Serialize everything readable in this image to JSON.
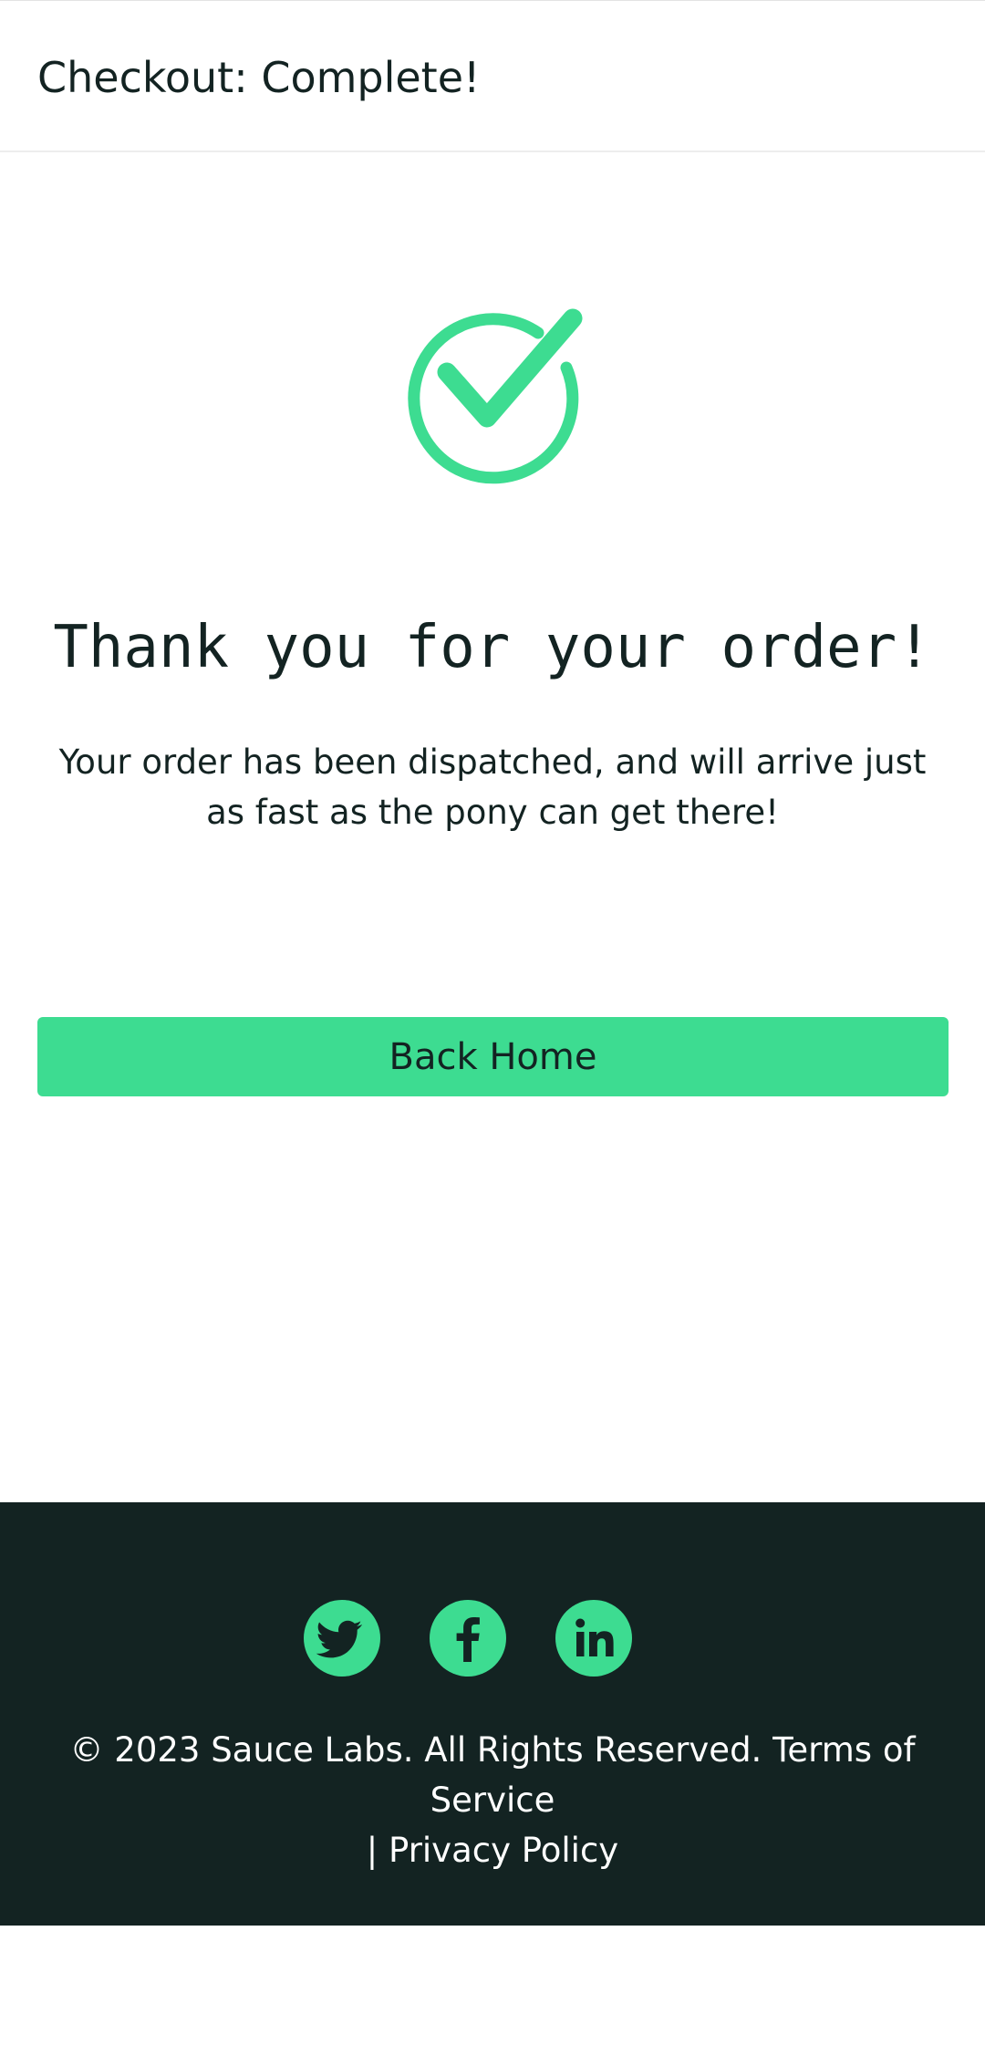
{
  "header": {
    "title": "Checkout: Complete!"
  },
  "main": {
    "success_icon": "checkmark-circle-icon",
    "heading": "Thank you for your order!",
    "message": "Your order has been dispatched, and will arrive just as fast as the pony can get there!",
    "back_home_label": "Back Home"
  },
  "footer": {
    "social_icons": [
      "twitter-icon",
      "facebook-icon",
      "linkedin-icon"
    ],
    "copyright": "© 2023 Sauce Labs. All Rights Reserved.",
    "terms_label": "Terms of Service",
    "separator": "|",
    "privacy_label": "Privacy Policy"
  },
  "colors": {
    "accent": "#3ddc91",
    "dark": "#132322",
    "background": "#ffffff"
  }
}
